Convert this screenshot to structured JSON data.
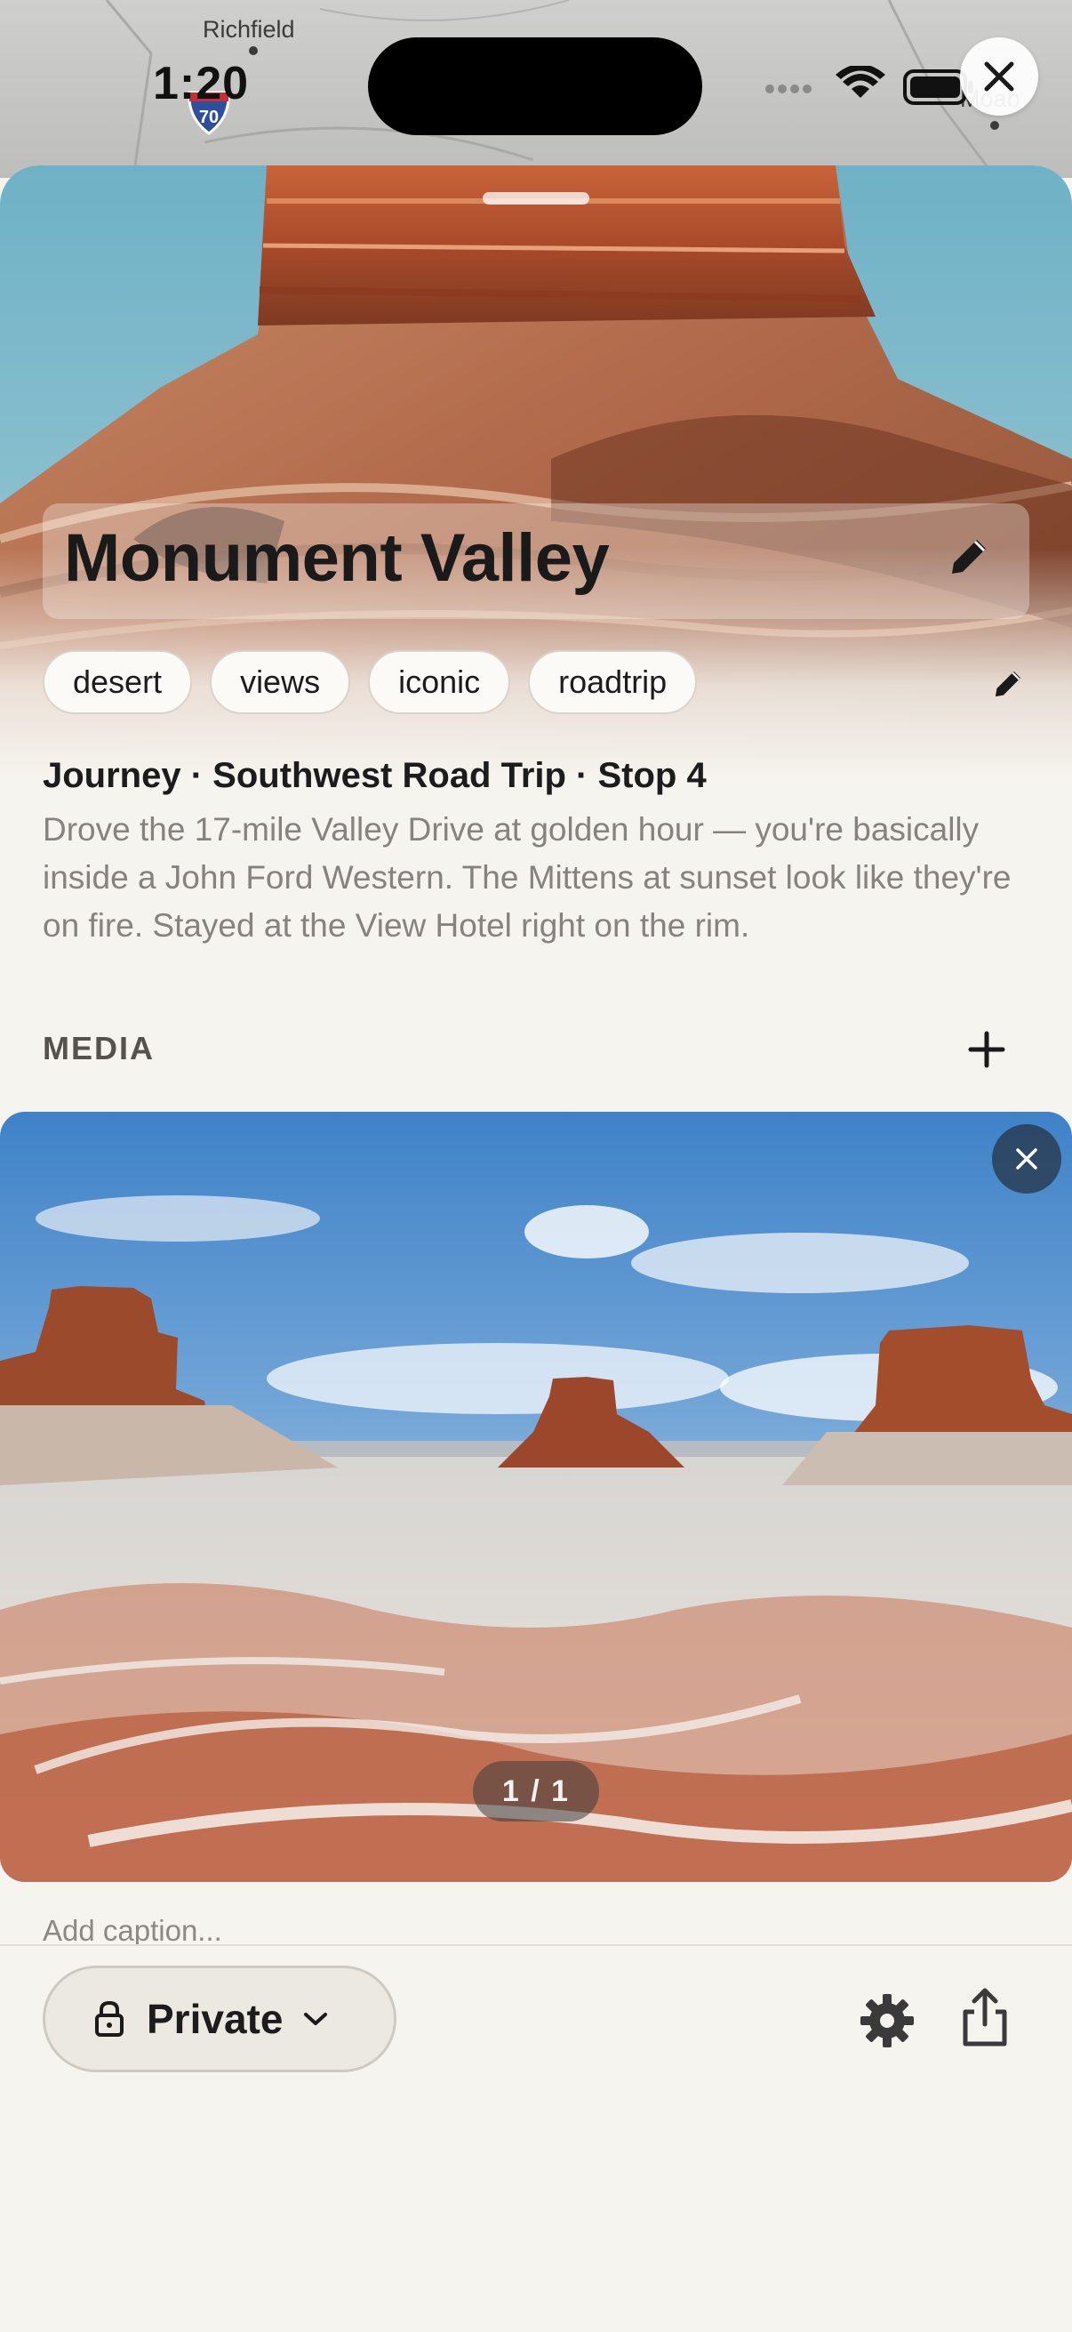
{
  "map": {
    "labels": [
      "Richfield",
      "Moab"
    ],
    "highway": "70"
  },
  "status_bar": {
    "time": "1:20"
  },
  "place": {
    "title": "Monument Valley"
  },
  "tags": [
    "desert",
    "views",
    "iconic",
    "roadtrip"
  ],
  "journey_line": "Journey · Southwest Road Trip · Stop 4",
  "description": "Drove the 17-mile Valley Drive at golden hour — you're basically inside a John Ford Western. The Mittens at sunset look like they're on fire. Stayed at the View Hotel right on the rim.",
  "media": {
    "section_label": "MEDIA",
    "counter": "1 / 1",
    "caption_placeholder": "Add caption..."
  },
  "bottom_bar": {
    "privacy_label": "Private"
  },
  "icons": [
    "close-icon",
    "pencil-icon",
    "plus-icon",
    "lock-icon",
    "chevron-down-icon",
    "gear-icon",
    "share-icon",
    "wifi-icon",
    "battery-icon"
  ],
  "colors": {
    "background": "#f6f4ef",
    "accent_text": "#1c1c1c",
    "muted_text": "#858280"
  }
}
